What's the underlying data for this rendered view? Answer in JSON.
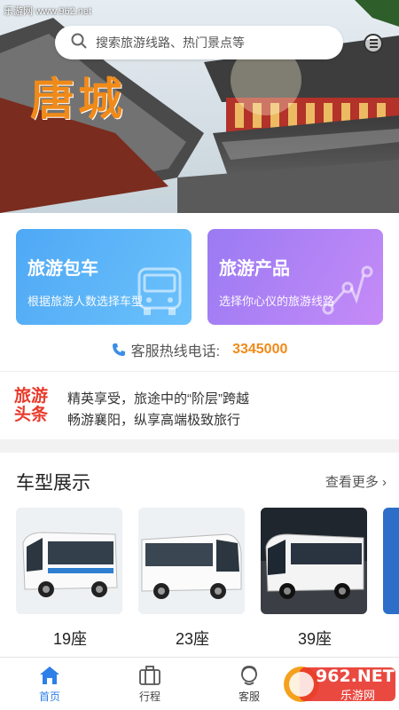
{
  "watermark_top": "乐游网 www.962.net",
  "search": {
    "placeholder": "搜索旅游线路、热门景点等"
  },
  "banner": {
    "city_title": "唐城"
  },
  "cards": [
    {
      "title": "旅游包车",
      "subtitle": "根据旅游人数选择车型",
      "icon": "bus-icon",
      "color": "#55aef7"
    },
    {
      "title": "旅游产品",
      "subtitle": "选择你心仪的旅游线路",
      "icon": "route-icon",
      "color": "#a97df5"
    }
  ],
  "hotline": {
    "label": "客服热线电话:",
    "number": "3345000",
    "icon": "phone-icon"
  },
  "news": {
    "logo_line1": "旅游",
    "logo_line2": "头条",
    "items": [
      "精英享受，旅途中的“阶层”跨越",
      "畅游襄阳，纵享高端极致旅行"
    ]
  },
  "vehicles": {
    "title": "车型展示",
    "more": "查看更多 ›",
    "items": [
      {
        "label": "19座"
      },
      {
        "label": "23座"
      },
      {
        "label": "39座"
      }
    ]
  },
  "tabs": [
    {
      "label": "首页",
      "icon": "home-icon",
      "active": true
    },
    {
      "label": "行程",
      "icon": "suitcase-icon",
      "active": false
    },
    {
      "label": "客服",
      "icon": "service-icon",
      "active": false
    }
  ],
  "watermark_bottom": {
    "brand": "962.NET",
    "sub": "乐游网"
  },
  "colors": {
    "accent_orange": "#f08a19",
    "tab_active": "#2f7fe8",
    "news_red": "#e93a2c"
  }
}
